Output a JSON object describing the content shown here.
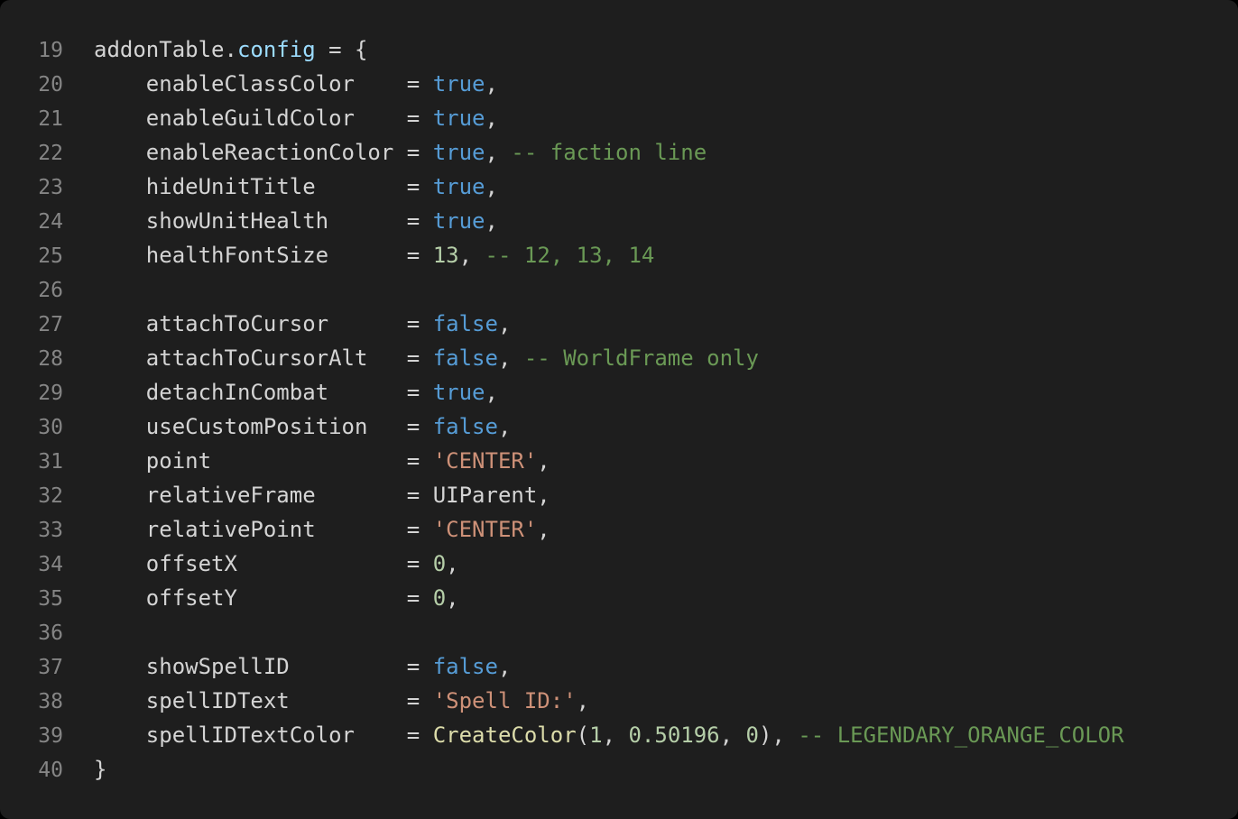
{
  "editor": {
    "background_color": "#1e1e1e",
    "outer_background_color": "#000000",
    "gutter_color": "#858585",
    "language": "lua",
    "colors": {
      "plain": "#d4d4d4",
      "property": "#9cdcfe",
      "keyword": "#569cd6",
      "number": "#b5cea8",
      "string": "#ce9178",
      "comment": "#6a9955",
      "function": "#dcdcaa"
    }
  },
  "lines": [
    {
      "number": "19",
      "tokens": [
        {
          "text": "addonTable",
          "type": "plain"
        },
        {
          "text": ".",
          "type": "punct"
        },
        {
          "text": "config",
          "type": "prop"
        },
        {
          "text": " = {",
          "type": "plain"
        }
      ]
    },
    {
      "number": "20",
      "tokens": [
        {
          "text": "    enableClassColor   ",
          "type": "plain"
        },
        {
          "text": " = ",
          "type": "plain"
        },
        {
          "text": "true",
          "type": "keyword"
        },
        {
          "text": ",",
          "type": "punct"
        }
      ]
    },
    {
      "number": "21",
      "tokens": [
        {
          "text": "    enableGuildColor   ",
          "type": "plain"
        },
        {
          "text": " = ",
          "type": "plain"
        },
        {
          "text": "true",
          "type": "keyword"
        },
        {
          "text": ",",
          "type": "punct"
        }
      ]
    },
    {
      "number": "22",
      "tokens": [
        {
          "text": "    enableReactionColor",
          "type": "plain"
        },
        {
          "text": " = ",
          "type": "plain"
        },
        {
          "text": "true",
          "type": "keyword"
        },
        {
          "text": ", ",
          "type": "punct"
        },
        {
          "text": "-- faction line",
          "type": "comment"
        }
      ]
    },
    {
      "number": "23",
      "tokens": [
        {
          "text": "    hideUnitTitle      ",
          "type": "plain"
        },
        {
          "text": " = ",
          "type": "plain"
        },
        {
          "text": "true",
          "type": "keyword"
        },
        {
          "text": ",",
          "type": "punct"
        }
      ]
    },
    {
      "number": "24",
      "tokens": [
        {
          "text": "    showUnitHealth     ",
          "type": "plain"
        },
        {
          "text": " = ",
          "type": "plain"
        },
        {
          "text": "true",
          "type": "keyword"
        },
        {
          "text": ",",
          "type": "punct"
        }
      ]
    },
    {
      "number": "25",
      "tokens": [
        {
          "text": "    healthFontSize     ",
          "type": "plain"
        },
        {
          "text": " = ",
          "type": "plain"
        },
        {
          "text": "13",
          "type": "number"
        },
        {
          "text": ", ",
          "type": "punct"
        },
        {
          "text": "-- 12, 13, 14",
          "type": "comment"
        }
      ]
    },
    {
      "number": "26",
      "tokens": []
    },
    {
      "number": "27",
      "tokens": [
        {
          "text": "    attachToCursor     ",
          "type": "plain"
        },
        {
          "text": " = ",
          "type": "plain"
        },
        {
          "text": "false",
          "type": "keyword"
        },
        {
          "text": ",",
          "type": "punct"
        }
      ]
    },
    {
      "number": "28",
      "tokens": [
        {
          "text": "    attachToCursorAlt  ",
          "type": "plain"
        },
        {
          "text": " = ",
          "type": "plain"
        },
        {
          "text": "false",
          "type": "keyword"
        },
        {
          "text": ", ",
          "type": "punct"
        },
        {
          "text": "-- WorldFrame only",
          "type": "comment"
        }
      ]
    },
    {
      "number": "29",
      "tokens": [
        {
          "text": "    detachInCombat     ",
          "type": "plain"
        },
        {
          "text": " = ",
          "type": "plain"
        },
        {
          "text": "true",
          "type": "keyword"
        },
        {
          "text": ",",
          "type": "punct"
        }
      ]
    },
    {
      "number": "30",
      "tokens": [
        {
          "text": "    useCustomPosition  ",
          "type": "plain"
        },
        {
          "text": " = ",
          "type": "plain"
        },
        {
          "text": "false",
          "type": "keyword"
        },
        {
          "text": ",",
          "type": "punct"
        }
      ]
    },
    {
      "number": "31",
      "tokens": [
        {
          "text": "    point              ",
          "type": "plain"
        },
        {
          "text": " = ",
          "type": "plain"
        },
        {
          "text": "'CENTER'",
          "type": "string"
        },
        {
          "text": ",",
          "type": "punct"
        }
      ]
    },
    {
      "number": "32",
      "tokens": [
        {
          "text": "    relativeFrame      ",
          "type": "plain"
        },
        {
          "text": " = ",
          "type": "plain"
        },
        {
          "text": "UIParent",
          "type": "plain"
        },
        {
          "text": ",",
          "type": "punct"
        }
      ]
    },
    {
      "number": "33",
      "tokens": [
        {
          "text": "    relativePoint      ",
          "type": "plain"
        },
        {
          "text": " = ",
          "type": "plain"
        },
        {
          "text": "'CENTER'",
          "type": "string"
        },
        {
          "text": ",",
          "type": "punct"
        }
      ]
    },
    {
      "number": "34",
      "tokens": [
        {
          "text": "    offsetX            ",
          "type": "plain"
        },
        {
          "text": " = ",
          "type": "plain"
        },
        {
          "text": "0",
          "type": "number"
        },
        {
          "text": ",",
          "type": "punct"
        }
      ]
    },
    {
      "number": "35",
      "tokens": [
        {
          "text": "    offsetY            ",
          "type": "plain"
        },
        {
          "text": " = ",
          "type": "plain"
        },
        {
          "text": "0",
          "type": "number"
        },
        {
          "text": ",",
          "type": "punct"
        }
      ]
    },
    {
      "number": "36",
      "tokens": []
    },
    {
      "number": "37",
      "tokens": [
        {
          "text": "    showSpellID        ",
          "type": "plain"
        },
        {
          "text": " = ",
          "type": "plain"
        },
        {
          "text": "false",
          "type": "keyword"
        },
        {
          "text": ",",
          "type": "punct"
        }
      ]
    },
    {
      "number": "38",
      "tokens": [
        {
          "text": "    spellIDText        ",
          "type": "plain"
        },
        {
          "text": " = ",
          "type": "plain"
        },
        {
          "text": "'Spell ID:'",
          "type": "string"
        },
        {
          "text": ",",
          "type": "punct"
        }
      ]
    },
    {
      "number": "39",
      "tokens": [
        {
          "text": "    spellIDTextColor   ",
          "type": "plain"
        },
        {
          "text": " = ",
          "type": "plain"
        },
        {
          "text": "CreateColor",
          "type": "function"
        },
        {
          "text": "(",
          "type": "punct"
        },
        {
          "text": "1",
          "type": "number"
        },
        {
          "text": ", ",
          "type": "punct"
        },
        {
          "text": "0.50196",
          "type": "number"
        },
        {
          "text": ", ",
          "type": "punct"
        },
        {
          "text": "0",
          "type": "number"
        },
        {
          "text": "), ",
          "type": "punct"
        },
        {
          "text": "-- LEGENDARY_ORANGE_COLOR",
          "type": "comment"
        }
      ]
    },
    {
      "number": "40",
      "tokens": [
        {
          "text": "}",
          "type": "plain"
        }
      ]
    }
  ]
}
